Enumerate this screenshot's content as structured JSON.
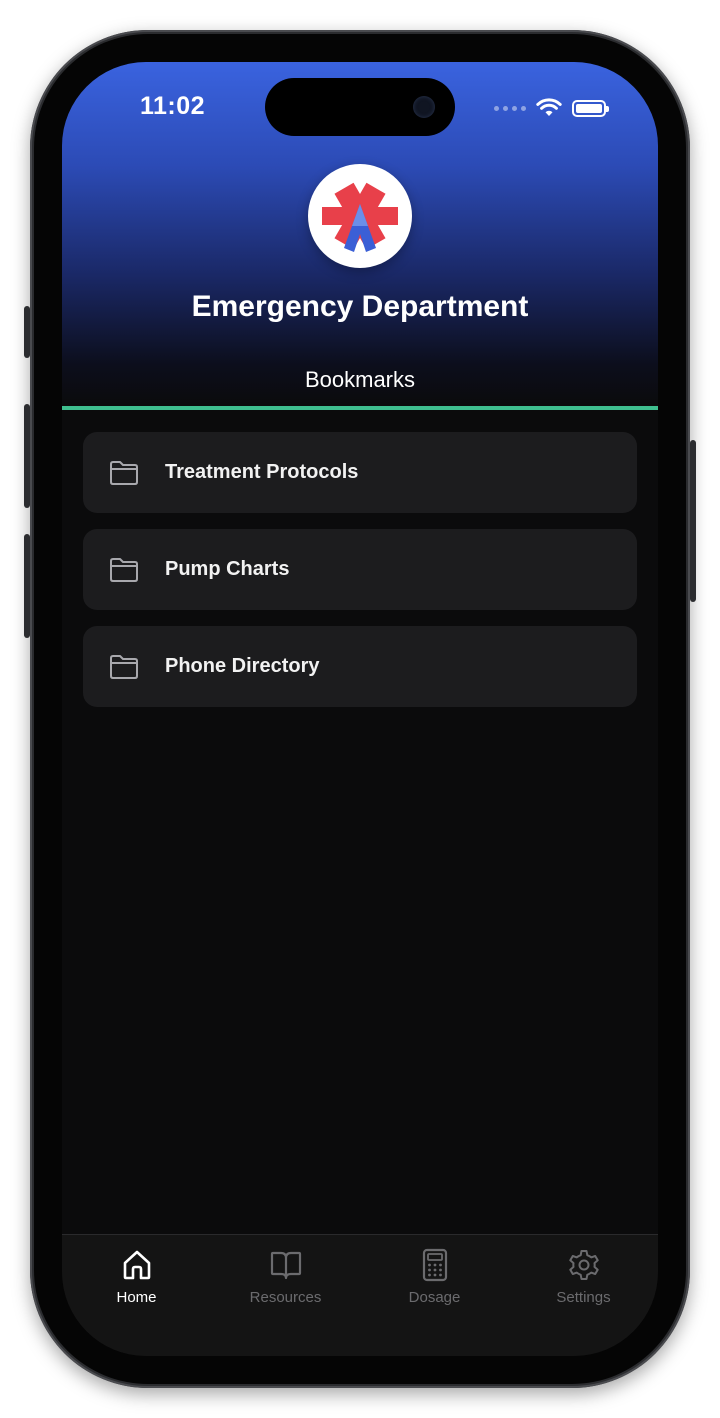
{
  "status_bar": {
    "time": "11:02"
  },
  "header": {
    "title": "Emergency Department",
    "section": "Bookmarks",
    "gradient_top": "#3a63df",
    "accent_underline": "#3fbf8f"
  },
  "bookmarks": [
    {
      "label": "Treatment Protocols",
      "icon": "folder-icon"
    },
    {
      "label": "Pump Charts",
      "icon": "folder-icon"
    },
    {
      "label": "Phone Directory",
      "icon": "folder-icon"
    }
  ],
  "tabbar": {
    "tabs": [
      {
        "label": "Home",
        "icon": "home-icon",
        "active": true
      },
      {
        "label": "Resources",
        "icon": "book-icon",
        "active": false
      },
      {
        "label": "Dosage",
        "icon": "calculator-icon",
        "active": false
      },
      {
        "label": "Settings",
        "icon": "gear-icon",
        "active": false
      }
    ]
  },
  "colors": {
    "background": "#0b0b0c",
    "card": "#1c1c1e",
    "tab_active": "#ffffff",
    "tab_inactive": "#6b6b6e",
    "logo_red": "#e8404a",
    "logo_blue": "#3b5fd6"
  }
}
